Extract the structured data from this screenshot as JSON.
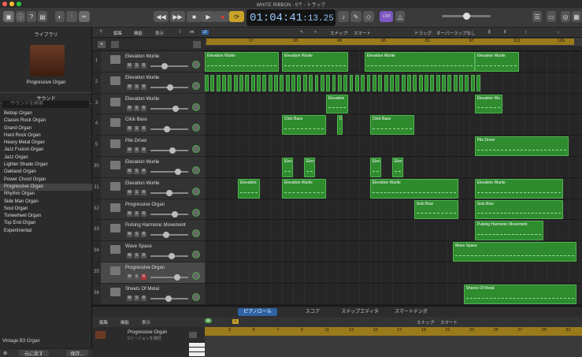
{
  "window": {
    "title": "WHITE RIBBON - 5个 - トラック"
  },
  "lcd": {
    "time": "01:04:41",
    "frames": ":13.25",
    "key": "c34"
  },
  "library": {
    "title": "ライブラリ",
    "preset": "Progressive Organ",
    "section": "サウンド",
    "search_placeholder": "サウンドを検索",
    "sounds": [
      "Bebop Organ",
      "Classic Rock Organ",
      "Grand Organ",
      "Hard Rock Organ",
      "Heavy Metal Organ",
      "Jazz Fusion Organ",
      "Jazz Organ",
      "Lighter Shade Organ",
      "Oakland Organ",
      "Power Chord Organ",
      "Progressive Organ",
      "Rhythm Organ",
      "Side Man Organ",
      "Soul Organ",
      "Tonewheel Organ",
      "Top End Organ",
      "Experimental"
    ],
    "selected_index": 10,
    "footer": "Vintage B3 Organ",
    "revert_label": "元に戻す",
    "save_label": "保存..."
  },
  "toolbar": {
    "edit": "編集",
    "function": "機能",
    "view": "表示",
    "step_label": "スナップ:",
    "snap": "スマート",
    "drag_label": "ドラッグ:",
    "drag": "オーバーラップなし"
  },
  "ruler": {
    "marks": [
      "1",
      "17",
      "33",
      "49",
      "65",
      "81",
      "97",
      "113",
      "129"
    ]
  },
  "tracks": [
    {
      "num": "1",
      "name": "Elevation Wurlie"
    },
    {
      "num": "2",
      "name": "Elevation Wurlie"
    },
    {
      "num": "3",
      "name": "Elevation Wurlie"
    },
    {
      "num": "4",
      "name": "Click Bass"
    },
    {
      "num": "5",
      "name": "Pile Driver"
    },
    {
      "num": "30",
      "name": "Elevation Wurlie"
    },
    {
      "num": "31",
      "name": "Elevation Wurlie"
    },
    {
      "num": "32",
      "name": "Progressive Organ"
    },
    {
      "num": "33",
      "name": "Pulsing Harmonic Movement"
    },
    {
      "num": "34",
      "name": "Wave Space"
    },
    {
      "num": "35",
      "name": "Progressive Organ"
    },
    {
      "num": "36",
      "name": "Sheets Of Metal"
    }
  ],
  "msr": {
    "m": "M",
    "s": "S",
    "r": "R"
  },
  "regions": [
    {
      "lane": 0,
      "start": 1,
      "end": 28,
      "label": "Elevation Wurlie"
    },
    {
      "lane": 0,
      "start": 29,
      "end": 53,
      "label": "Elevation Wurlie"
    },
    {
      "lane": 0,
      "start": 59,
      "end": 99,
      "label": "Elevation Wurlie"
    },
    {
      "lane": 0,
      "start": 99,
      "end": 115,
      "label": "Elevation Wurlie"
    },
    {
      "lane": 1,
      "start": 1,
      "end": 100,
      "label": ""
    },
    {
      "lane": 2,
      "start": 45,
      "end": 53,
      "label": "Elevation"
    },
    {
      "lane": 2,
      "start": 99,
      "end": 109,
      "label": "Elevation Wu"
    },
    {
      "lane": 3,
      "start": 29,
      "end": 45,
      "label": "Click Bass"
    },
    {
      "lane": 3,
      "start": 49,
      "end": 51,
      "label": "C"
    },
    {
      "lane": 3,
      "start": 61,
      "end": 77,
      "label": "Click Bass"
    },
    {
      "lane": 4,
      "start": 99,
      "end": 133,
      "label": "Pile Driver"
    },
    {
      "lane": 5,
      "start": 29,
      "end": 33,
      "label": "Elev"
    },
    {
      "lane": 5,
      "start": 37,
      "end": 41,
      "label": "Elev"
    },
    {
      "lane": 5,
      "start": 61,
      "end": 65,
      "label": "Elev"
    },
    {
      "lane": 5,
      "start": 69,
      "end": 73,
      "label": "Elev"
    },
    {
      "lane": 6,
      "start": 13,
      "end": 21,
      "label": "Elevation"
    },
    {
      "lane": 6,
      "start": 29,
      "end": 45,
      "label": "Elevation Wurlie"
    },
    {
      "lane": 6,
      "start": 61,
      "end": 93,
      "label": "Elevation Wurlie"
    },
    {
      "lane": 6,
      "start": 99,
      "end": 131,
      "label": "Elevation Wurlie"
    },
    {
      "lane": 7,
      "start": 77,
      "end": 93,
      "label": "Solo Bow"
    },
    {
      "lane": 7,
      "start": 99,
      "end": 131,
      "label": "Solo Bow"
    },
    {
      "lane": 8,
      "start": 99,
      "end": 124,
      "label": "Pulsing Harmonic Movement"
    },
    {
      "lane": 9,
      "start": 91,
      "end": 136,
      "label": "Wave Space"
    },
    {
      "lane": 11,
      "start": 95,
      "end": 136,
      "label": "Sheets Of Metal"
    }
  ],
  "editor": {
    "tabs": [
      "ピアノロール",
      "スコア",
      "ステップエディタ",
      "スマートテンポ"
    ],
    "track_name": "Progressive Organ",
    "sub": "0リージョンを選択",
    "snap_label": "スナップ:",
    "snap": "スマート",
    "ruler": [
      "3",
      "5",
      "7",
      "9",
      "11",
      "13",
      "15",
      "17",
      "19",
      "21",
      "23",
      "25",
      "27",
      "29",
      "31"
    ]
  }
}
